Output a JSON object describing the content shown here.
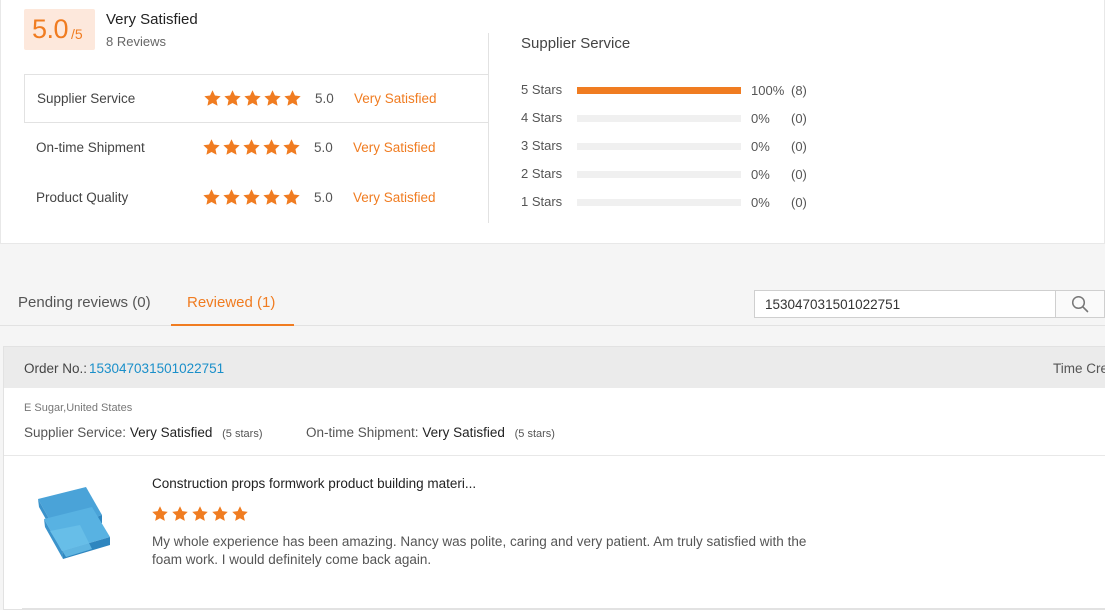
{
  "colors": {
    "accent": "#f07c21",
    "link": "#1a8fc9",
    "star": "#f07c21"
  },
  "summary": {
    "score": "5.0",
    "score_max": "/5",
    "overall_label": "Very Satisfied",
    "reviews_count": "8 Reviews",
    "metrics": [
      {
        "name": "Supplier Service",
        "stars": 5,
        "score": "5.0",
        "label": "Very Satisfied"
      },
      {
        "name": "On-time Shipment",
        "stars": 5,
        "score": "5.0",
        "label": "Very Satisfied"
      },
      {
        "name": "Product Quality",
        "stars": 5,
        "score": "5.0",
        "label": "Very Satisfied"
      }
    ]
  },
  "distribution": {
    "title": "Supplier Service",
    "rows": [
      {
        "label": "5  Stars",
        "fraction": 1.0,
        "percent": "100%",
        "count": "(8)"
      },
      {
        "label": "4  Stars",
        "fraction": 0,
        "percent": "0%",
        "count": "(0)"
      },
      {
        "label": "3  Stars",
        "fraction": 0,
        "percent": "0%",
        "count": "(0)"
      },
      {
        "label": "2  Stars",
        "fraction": 0,
        "percent": "0%",
        "count": "(0)"
      },
      {
        "label": "1  Stars",
        "fraction": 0,
        "percent": "0%",
        "count": "(0)"
      }
    ]
  },
  "tabs": {
    "pending": "Pending reviews (0)",
    "reviewed": "Reviewed (1)"
  },
  "search": {
    "value": "153047031501022751",
    "icon": "search-icon"
  },
  "order": {
    "label": "Order No.:",
    "number": "153047031501022751",
    "time_created_label": "Time Cre",
    "buyer": "E Sugar,United States",
    "supplier_service": {
      "label": "Supplier Service:",
      "value": "Very Satisfied",
      "stars": "(5 stars)"
    },
    "on_time_shipment": {
      "label": "On-time Shipment:",
      "value": "Very Satisfied",
      "stars": "(5 stars)"
    },
    "product": {
      "title": "Construction props formwork product building materi...",
      "stars": 5,
      "review": "My whole experience has been amazing. Nancy was polite, caring and very patient. Am truly satisfied with the foam work. I would definitely  come back again."
    }
  }
}
